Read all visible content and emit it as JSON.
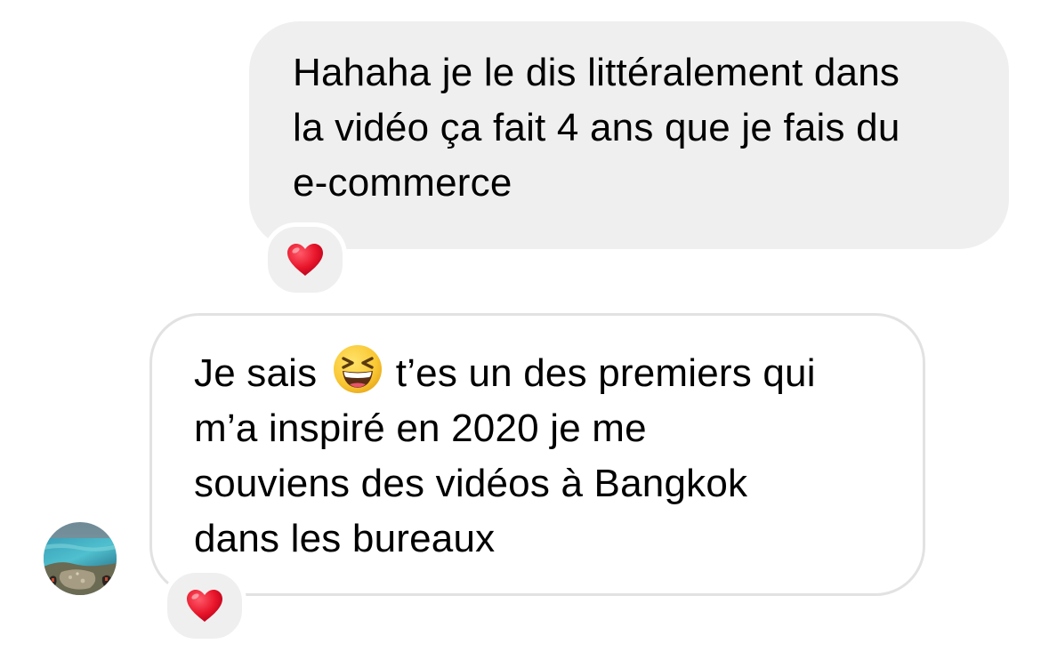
{
  "conversation": {
    "sent_message": {
      "lines": [
        "Hahaha je le dis littéralement dans",
        "la vidéo ça fait 4 ans que je fais du",
        "e-commerce"
      ],
      "reaction": "red-heart-icon"
    },
    "received_message": {
      "line1_before": "Je sais",
      "line1_emoji": "grinning-squinting-face-icon",
      "line1_after": "t’es un des premiers qui",
      "lines": [
        "m’a inspiré en 2020 je me",
        "souviens des vidéos à Bangkok",
        "dans les bureaux"
      ],
      "reaction": "red-heart-icon",
      "avatar": "contact-avatar"
    }
  },
  "colors": {
    "sent_bubble": "#efefef",
    "received_border": "#e2e2e2",
    "heart": "#e8162b",
    "text": "#000000"
  }
}
